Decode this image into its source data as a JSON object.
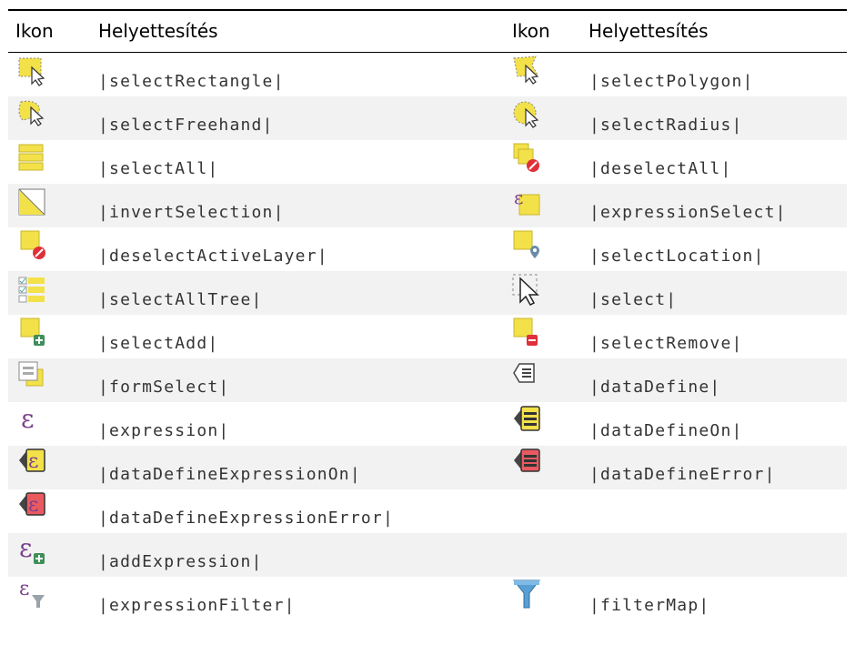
{
  "headers": {
    "icon_left": "Ikon",
    "sub_left": "Helyettesítés",
    "icon_right": "Ikon",
    "sub_right": "Helyettesítés"
  },
  "rows": [
    {
      "left": {
        "icon": "select-rectangle-icon",
        "text": "|selectRectangle|"
      },
      "right": {
        "icon": "select-polygon-icon",
        "text": "|selectPolygon|"
      }
    },
    {
      "left": {
        "icon": "select-freehand-icon",
        "text": "|selectFreehand|"
      },
      "right": {
        "icon": "select-radius-icon",
        "text": "|selectRadius|"
      }
    },
    {
      "left": {
        "icon": "select-all-icon",
        "text": "|selectAll|"
      },
      "right": {
        "icon": "deselect-all-icon",
        "text": "|deselectAll|"
      }
    },
    {
      "left": {
        "icon": "invert-selection-icon",
        "text": "|invertSelection|"
      },
      "right": {
        "icon": "expression-select-icon",
        "text": "|expressionSelect|"
      }
    },
    {
      "left": {
        "icon": "deselect-active-layer-icon",
        "text": "|deselectActiveLayer|"
      },
      "right": {
        "icon": "select-location-icon",
        "text": "|selectLocation|"
      }
    },
    {
      "left": {
        "icon": "select-all-tree-icon",
        "text": "|selectAllTree|"
      },
      "right": {
        "icon": "select-cursor-icon",
        "text": "|select|"
      }
    },
    {
      "left": {
        "icon": "select-add-icon",
        "text": "|selectAdd|"
      },
      "right": {
        "icon": "select-remove-icon",
        "text": "|selectRemove|"
      }
    },
    {
      "left": {
        "icon": "form-select-icon",
        "text": "|formSelect|"
      },
      "right": {
        "icon": "data-define-icon",
        "text": "|dataDefine|"
      }
    },
    {
      "left": {
        "icon": "expression-icon",
        "text": "|expression|"
      },
      "right": {
        "icon": "data-define-on-icon",
        "text": "|dataDefineOn|"
      }
    },
    {
      "left": {
        "icon": "data-define-expression-on-icon",
        "text": "|dataDefineExpressionOn|"
      },
      "right": {
        "icon": "data-define-error-icon",
        "text": "|dataDefineError|"
      }
    },
    {
      "left": {
        "icon": "data-define-expression-error-icon",
        "text": "|dataDefineExpressionError|"
      },
      "right": {
        "icon": "",
        "text": ""
      }
    },
    {
      "left": {
        "icon": "add-expression-icon",
        "text": "|addExpression|"
      },
      "right": {
        "icon": "",
        "text": ""
      }
    },
    {
      "left": {
        "icon": "expression-filter-icon",
        "text": "|expressionFilter|"
      },
      "right": {
        "icon": "filter-map-icon",
        "text": "|filterMap|"
      }
    }
  ],
  "colors": {
    "header_rule": "#000000",
    "odd_row": "#f2f2f2",
    "even_row": "#ffffff",
    "code_text": "#333333",
    "icon_yellow": "#f3e14a",
    "icon_red": "#e0303a",
    "icon_purple": "#7b3f8c"
  }
}
